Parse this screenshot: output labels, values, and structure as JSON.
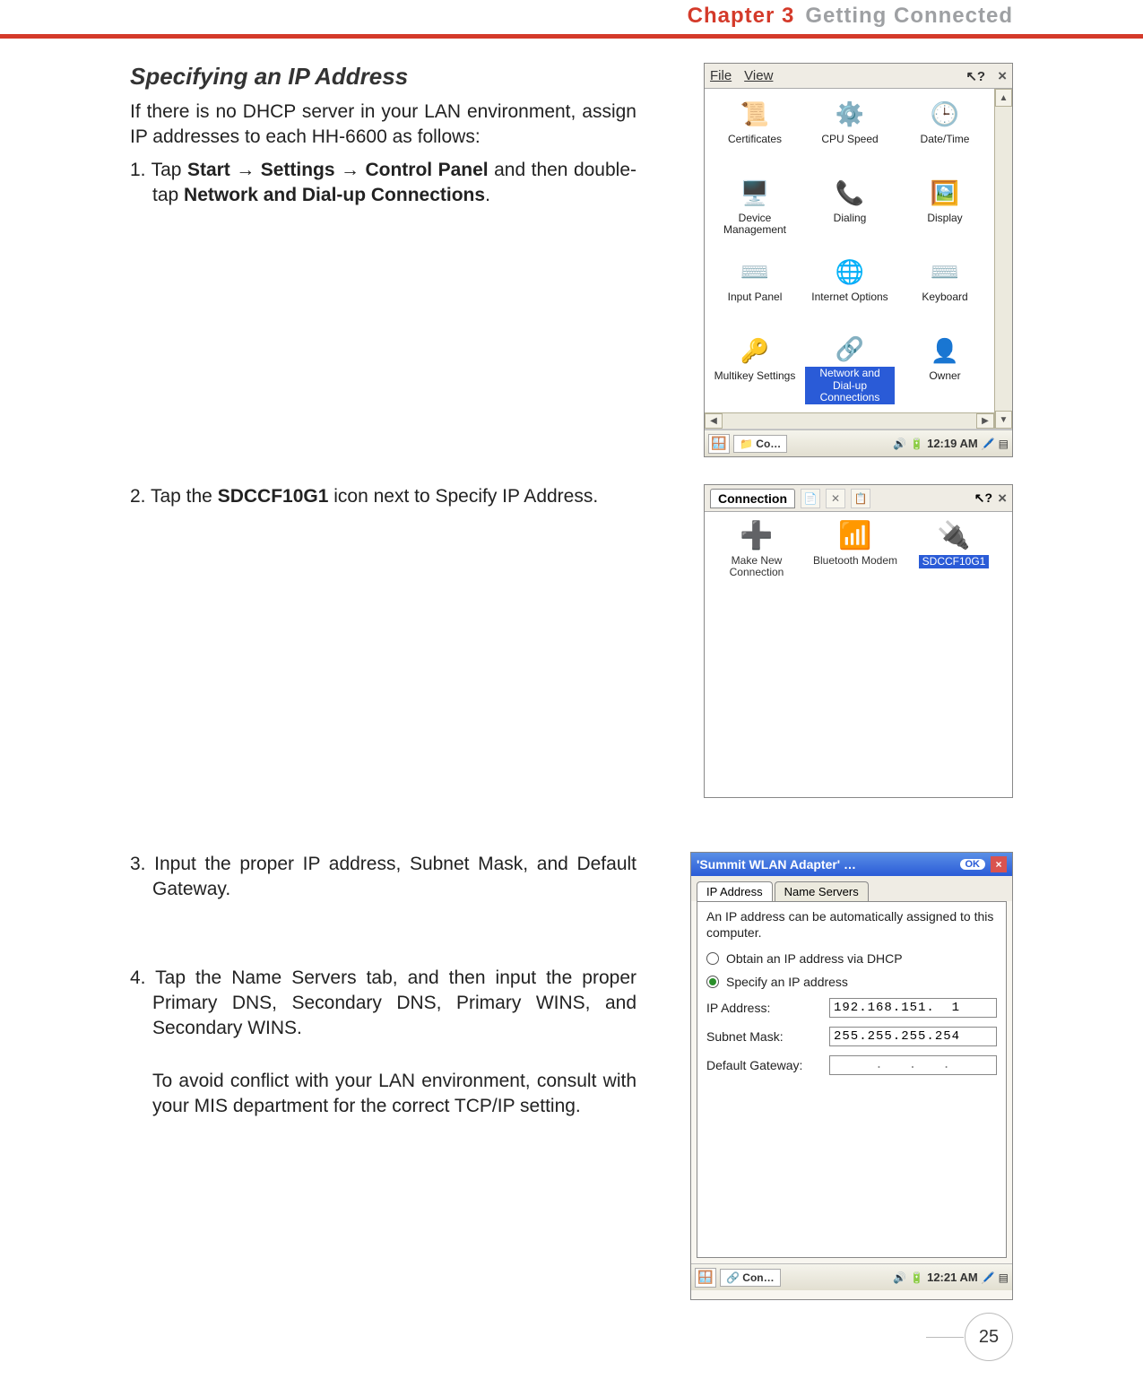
{
  "header": {
    "chapter_num": "Chapter 3",
    "chapter_title": "Getting Connected"
  },
  "section_title": "Specifying an IP Address",
  "intro": "If there is no DHCP server in your LAN environment, assign IP addresses to each HH-6600 as follows:",
  "step1_pre": "1. Tap ",
  "step1_b1": "Start → Settings → Control Panel",
  "step1_mid": " and then double-tap ",
  "step1_b2": "Network and Dial-up Connections",
  "step1_post": ".",
  "step2_pre": "2. Tap the ",
  "step2_b": "SDCCF10G1",
  "step2_post": " icon next to Specify IP Address.",
  "step3": "3. Input the proper IP address, Subnet Mask, and Default Gateway.",
  "step4": "4. Tap the Name Servers tab, and then input the proper Primary DNS, Secondary DNS, Primary WINS, and Secondary WINS.",
  "step4_note": "To avoid conflict with your LAN environment, consult with your MIS department for the correct TCP/IP setting.",
  "page_number": "25",
  "shot1": {
    "menu_file": "File",
    "menu_view": "View",
    "help_icon": "?",
    "close_icon": "×",
    "items": {
      "i0": "Certificates",
      "i1": "CPU Speed",
      "i2": "Date/Time",
      "i3": "Device Management",
      "i4": "Dialing",
      "i5": "Display",
      "i6": "Input Panel",
      "i7": "Internet Options",
      "i8": "Keyboard",
      "i9": "Multikey Settings",
      "i10": "Network and Dial-up Connections",
      "i11": "Owner"
    },
    "task": "Co…",
    "time": "12:19 AM"
  },
  "shot2": {
    "tab": "Connection",
    "items": {
      "c0": "Make New Connection",
      "c1": "Bluetooth Modem",
      "c2": "SDCCF10G1"
    },
    "help_icon": "?",
    "close_icon": "×"
  },
  "shot3": {
    "title": "'Summit WLAN Adapter' …",
    "ok": "OK",
    "tab_ip": "IP Address",
    "tab_ns": "Name Servers",
    "note": "An IP address can be automatically assigned to this computer.",
    "radio_dhcp": "Obtain an IP address via DHCP",
    "radio_spec": "Specify an IP address",
    "lbl_ip": "IP Address:",
    "lbl_mask": "Subnet Mask:",
    "lbl_gw": "Default Gateway:",
    "val_ip": "192.168.151.  1",
    "val_mask": "255.255.255.254",
    "val_gw": ".   .   .",
    "task": "Con…",
    "time": "12:21 AM"
  }
}
